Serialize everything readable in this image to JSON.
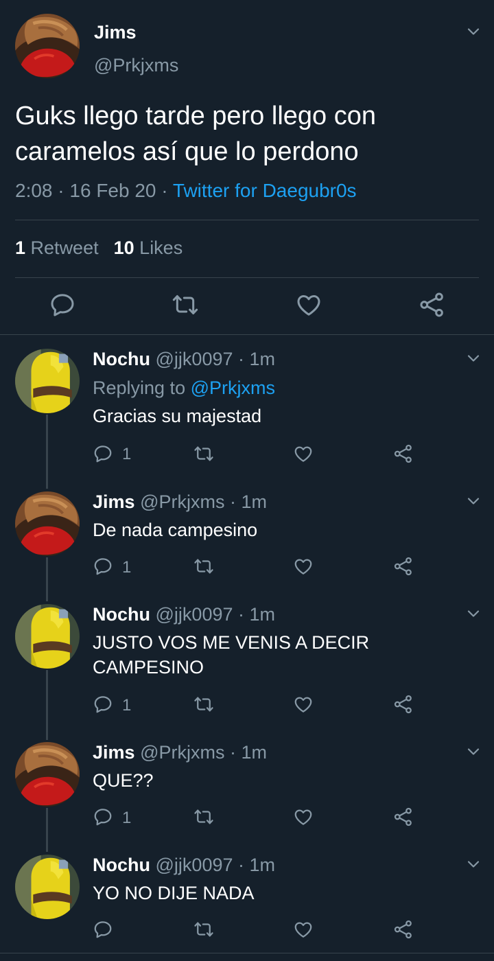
{
  "main_tweet": {
    "name": "Jims",
    "handle": "@Prkjxms",
    "text_line1": "Guks llego tarde pero llego con",
    "text_line2": "caramelos así que lo perdono",
    "time": "2:08",
    "date": "16 Feb 20",
    "separator": "·",
    "source": "Twitter for Daegubr0s",
    "retweet_count": "1",
    "retweet_label": "Retweet",
    "likes_count": "10",
    "likes_label": "Likes"
  },
  "replies": [
    {
      "name": "Nochu",
      "handle": "@jjk0097",
      "time": "1m",
      "replying_label": "Replying to",
      "replying_to": "@Prkjxms",
      "text": "Gracias su majestad",
      "reply_count": "1"
    },
    {
      "name": "Jims",
      "handle": "@Prkjxms",
      "time": "1m",
      "text": "De nada campesino",
      "reply_count": "1"
    },
    {
      "name": "Nochu",
      "handle": "@jjk0097",
      "time": "1m",
      "text_line1": "JUSTO VOS ME VENIS A DECIR",
      "text_line2": "CAMPESINO",
      "reply_count": "1"
    },
    {
      "name": "Jims",
      "handle": "@Prkjxms",
      "time": "1m",
      "text": "QUE??",
      "reply_count": "1"
    },
    {
      "name": "Nochu",
      "handle": "@jjk0097",
      "time": "1m",
      "text": "YO NO DIJE NADA",
      "reply_count": ""
    }
  ],
  "colors": {
    "background": "#15202b",
    "accent": "#1da1f2",
    "secondary_text": "#8899a6",
    "divider": "#38444d"
  }
}
